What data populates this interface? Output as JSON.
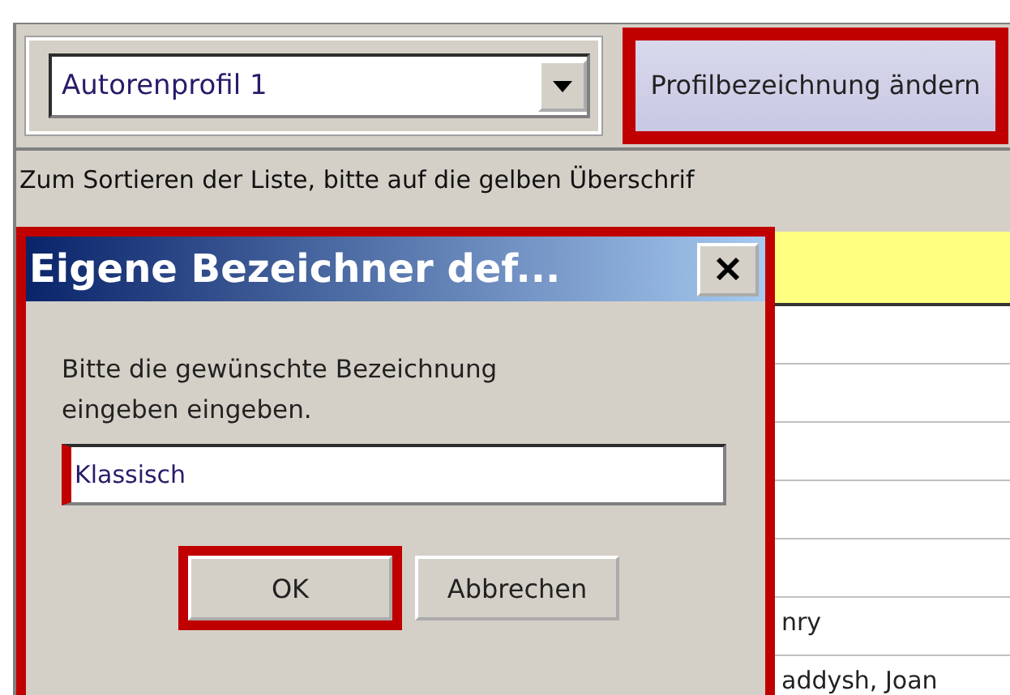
{
  "profile_select": {
    "value": "Autorenprofil 1"
  },
  "rename_button": {
    "label": "Profilbezeichnung ändern",
    "highlighted": true
  },
  "hint": "Zum Sortieren der Liste, bitte auf die gelben Überschrif",
  "table": {
    "rows": [
      {
        "column_1": ""
      },
      {
        "column_1": ""
      },
      {
        "column_1": ""
      },
      {
        "column_1": ""
      },
      {
        "column_1": ""
      },
      {
        "column_1": "nry"
      },
      {
        "column_1": "addysh, Joan"
      }
    ]
  },
  "dialog": {
    "title": "Eigene Bezeichner def...",
    "message": "Bitte die gewünschte Bezeichnung eingeben eingeben.",
    "field": {
      "value": "Klassisch",
      "highlighted": true
    },
    "buttons": [
      {
        "label": "OK",
        "highlighted": true
      },
      {
        "label": "Abbrechen",
        "highlighted": false
      }
    ]
  }
}
